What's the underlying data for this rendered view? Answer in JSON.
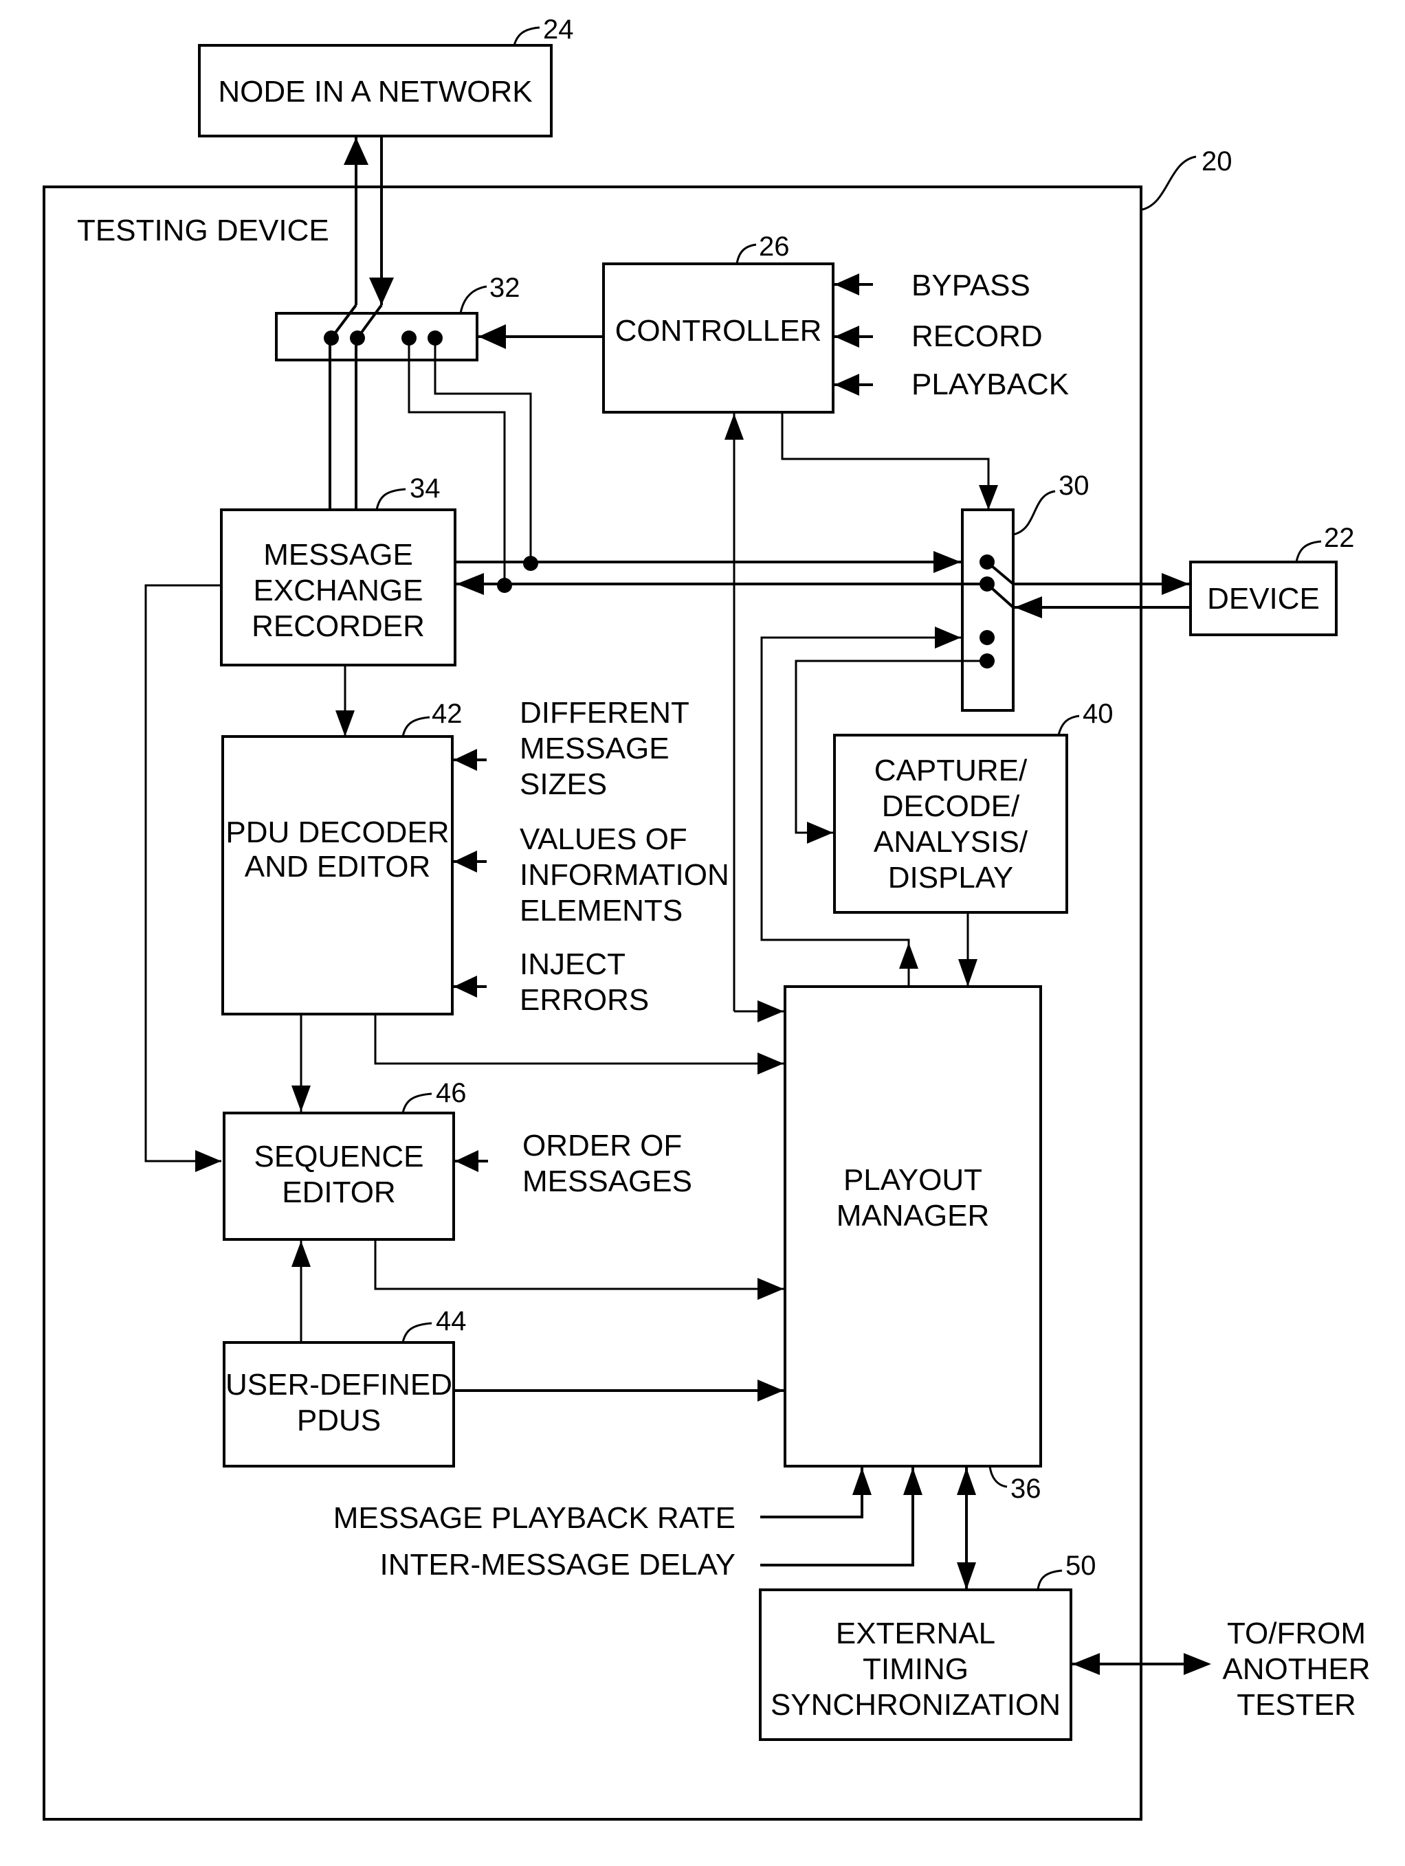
{
  "diagram": {
    "blocks": {
      "node": {
        "ref": "24",
        "lines": [
          "NODE IN A NETWORK"
        ]
      },
      "testing_device": {
        "ref": "20",
        "label": "TESTING DEVICE"
      },
      "controller": {
        "ref": "26",
        "lines": [
          "CONTROLLER"
        ]
      },
      "switch_top": {
        "ref": "32"
      },
      "switch_right": {
        "ref": "30"
      },
      "device": {
        "ref": "22",
        "lines": [
          "DEVICE"
        ]
      },
      "recorder": {
        "ref": "34",
        "lines": [
          "MESSAGE",
          "EXCHANGE",
          "RECORDER"
        ]
      },
      "pdu_decoder": {
        "ref": "42",
        "lines": [
          "PDU DECODER",
          "AND EDITOR"
        ]
      },
      "capture": {
        "ref": "40",
        "lines": [
          "CAPTURE/",
          "DECODE/",
          "ANALYSIS/",
          "DISPLAY"
        ]
      },
      "sequence_editor": {
        "ref": "46",
        "lines": [
          "SEQUENCE",
          "EDITOR"
        ]
      },
      "user_pdus": {
        "ref": "44",
        "lines": [
          "USER-DEFINED",
          "PDUS"
        ]
      },
      "playout": {
        "ref": "36",
        "lines": [
          "PLAYOUT",
          "MANAGER"
        ]
      },
      "ext_timing": {
        "ref": "50",
        "lines": [
          "EXTERNAL",
          "TIMING",
          "SYNCHRONIZATION"
        ]
      }
    },
    "inputs": {
      "controller": [
        "BYPASS",
        "RECORD",
        "PLAYBACK"
      ],
      "pdu_sizes": [
        "DIFFERENT",
        "MESSAGE",
        "SIZES"
      ],
      "pdu_values": [
        "VALUES OF",
        "INFORMATION",
        "ELEMENTS"
      ],
      "pdu_errors": [
        "INJECT",
        "ERRORS"
      ],
      "sequence_order": [
        "ORDER OF",
        "MESSAGES"
      ],
      "playback_rate": "MESSAGE  PLAYBACK  RATE",
      "inter_delay": "INTER-MESSAGE DELAY",
      "other_tester": [
        "TO/FROM",
        "ANOTHER",
        "TESTER"
      ]
    }
  }
}
